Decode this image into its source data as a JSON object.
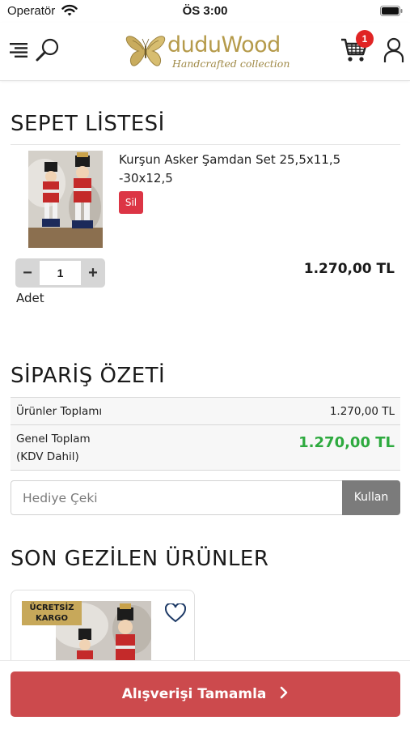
{
  "status_bar": {
    "carrier": "Operatör",
    "time": "ÖS 3:00"
  },
  "header": {
    "logo_name": "duduWood",
    "logo_tagline": "Handcrafted collection",
    "cart_count": "1"
  },
  "cart": {
    "title": "SEPET LİSTESİ",
    "item": {
      "name": "Kurşun Asker Şamdan Set 25,5x11,5 -30x12,5",
      "delete_label": "Sil",
      "qty_minus": "−",
      "qty_value": "1",
      "qty_plus": "+",
      "qty_label": "Adet",
      "price": "1.270,00 TL"
    }
  },
  "summary": {
    "title": "SİPARİŞ ÖZETİ",
    "products_total_label": "Ürünler Toplamı",
    "products_total_value": "1.270,00 TL",
    "grand_total_label_1": "Genel Toplam",
    "grand_total_label_2": "(KDV Dahil)",
    "grand_total_value": "1.270,00 TL"
  },
  "coupon": {
    "placeholder": "Hediye Çeki",
    "button_label": "Kullan"
  },
  "recent": {
    "title": "SON GEZİLEN ÜRÜNLER",
    "badge_line_1": "ÜCRETSİZ",
    "badge_line_2": "KARGO"
  },
  "checkout": {
    "button_label": "Alışverişi Tamamla"
  },
  "colors": {
    "accent_red": "#cc4a4d",
    "delete_red": "#dc3545",
    "total_green": "#2eaa3f",
    "logo_gold": "#b59a4a",
    "badge_gold": "#c7a85a"
  }
}
